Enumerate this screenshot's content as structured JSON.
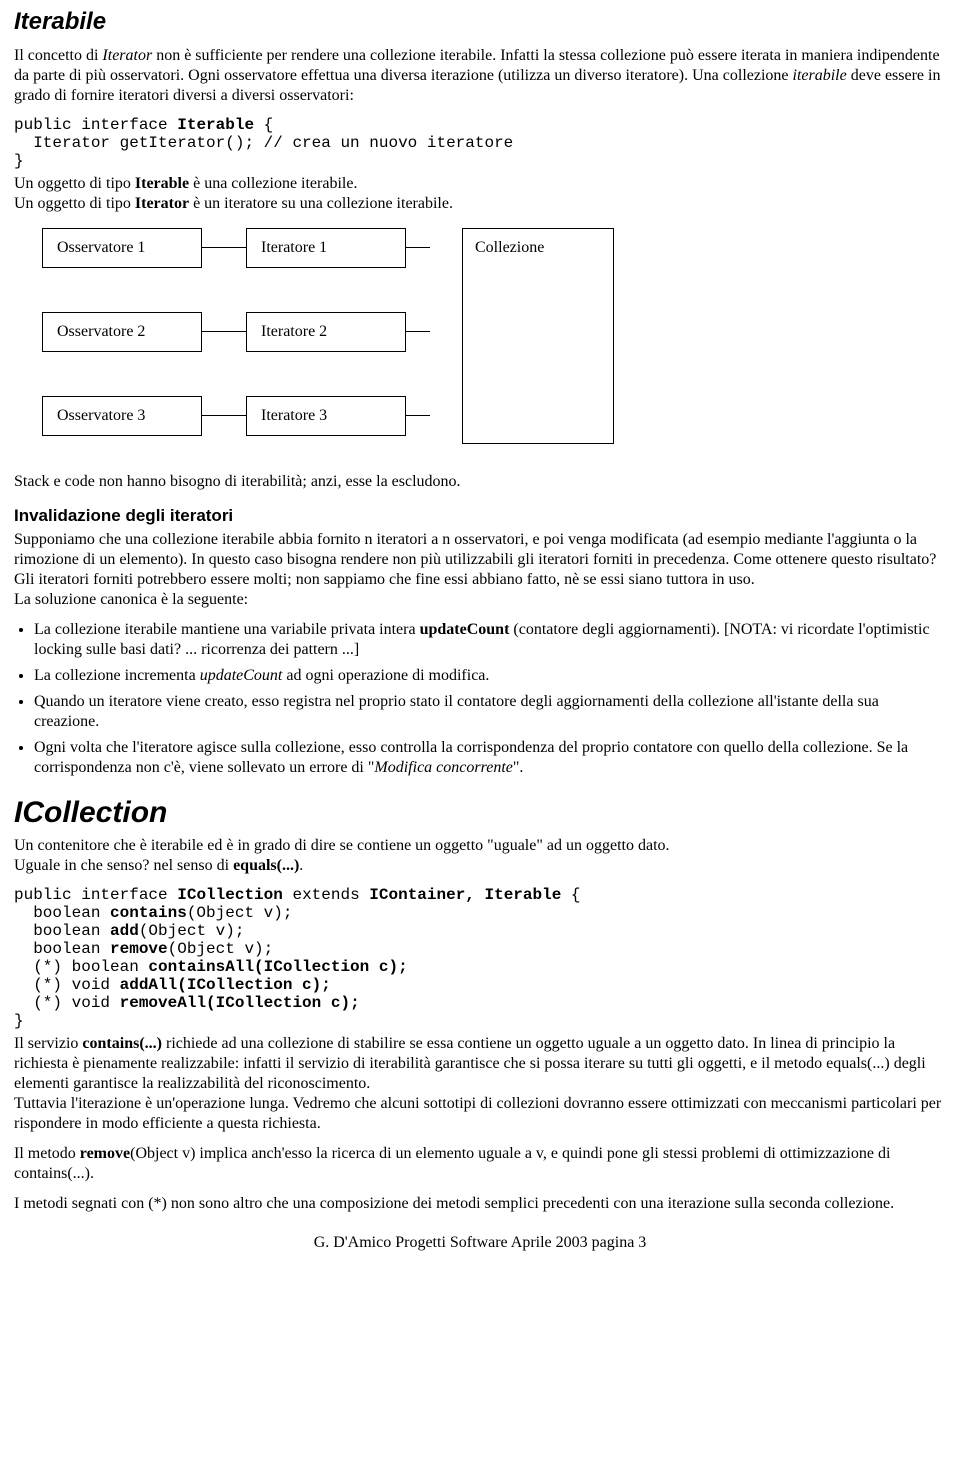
{
  "h_iterabile": "Iterabile",
  "p_iter_intro": "Il concetto di <i>Iterator</i> non è sufficiente per rendere una collezione iterabile. Infatti la stessa collezione può essere iterata in maniera indipendente da parte di più osservatori. Ogni osservatore effettua una diversa iterazione (utilizza un diverso iteratore). Una collezione <i>iterabile</i> deve essere in grado di fornire iteratori diversi a diversi osservatori:",
  "code_iterable": "public interface <b>Iterable</b> {\n  Iterator getIterator(); // crea un nuovo iteratore\n}",
  "p_iter_tail": "Un oggetto di tipo <b>Iterable</b> è una collezione iterabile.<br>Un oggetto di tipo <b>Iterator</b> è un iteratore su una collezione iterabile.",
  "diagram": {
    "obs1": "Osservatore 1",
    "obs2": "Osservatore 2",
    "obs3": "Osservatore 3",
    "it1": "Iteratore 1",
    "it2": "Iteratore 2",
    "it3": "Iteratore 3",
    "coll": "Collezione"
  },
  "p_stack": "Stack e code non hanno bisogno di iterabilità; anzi, esse la escludono.",
  "h_invalid": "Invalidazione degli iteratori",
  "p_invalid": "Supponiamo che una collezione iterabile abbia fornito n iteratori a n osservatori, e poi venga modificata (ad esempio mediante l'aggiunta o la rimozione di un elemento). In questo caso bisogna rendere non più utilizzabili gli iteratori forniti in precedenza. Come ottenere questo risultato? Gli iteratori forniti potrebbero essere molti; non sappiamo che fine essi abbiano fatto, nè se essi siano tuttora in uso.<br>La soluzione canonica è la seguente:",
  "bullets": [
    "La collezione iterabile mantiene una variabile privata intera <b>updateCount</b> (contatore degli aggiornamenti). [NOTA: vi ricordate l'optimistic locking sulle basi dati? ... ricorrenza dei pattern ...]",
    "La collezione incrementa <i>updateCount</i> ad ogni operazione di modifica.",
    "Quando un iteratore viene creato, esso registra nel proprio stato il contatore degli aggiornamenti della collezione all'istante della sua creazione.",
    "Ogni volta che l'iteratore agisce sulla collezione, esso controlla la corrispondenza del proprio contatore con quello della collezione. Se la corrispondenza non c'è, viene sollevato un errore di \"<i>Modifica concorrente</i>\"."
  ],
  "h_icollection": "ICollection",
  "p_icoll_intro": "Un contenitore che è iterabile ed è in grado di dire se contiene un oggetto \"uguale\" ad un oggetto dato.<br>Uguale in che senso? nel senso di <b>equals(...)</b>.",
  "code_icoll": "public interface <b>ICollection</b> extends <b>IContainer, Iterable</b> {\n  boolean <b>contains</b>(Object v);\n  boolean <b>add</b>(Object v);\n  boolean <b>remove</b>(Object v);\n  (*) boolean <b>containsAll(ICollection c);</b>\n  (*) void <b>addAll(ICollection c);</b>\n  (*) void <b>removeAll(ICollection c);</b>\n}",
  "p_contains": "Il servizio <b>contains(...)</b> richiede ad una collezione di stabilire se essa contiene un oggetto uguale a un oggetto dato. In linea di principio la richiesta è pienamente realizzabile: infatti il servizio di iterabilità garantisce che si possa iterare su tutti gli oggetti, e il metodo equals(...) degli elementi garantisce la realizzabilità del riconoscimento.<br>Tuttavia l'iterazione è un'operazione lunga. Vedremo che alcuni sottotipi di collezioni dovranno essere ottimizzati con meccanismi particolari per rispondere in modo efficiente a questa richiesta.",
  "p_remove": "Il metodo <b>remove</b>(Object v) implica anch'esso la ricerca di un elemento uguale a v, e quindi pone gli stessi problemi di ottimizzazione di contains(...).",
  "p_star": "I metodi segnati con (*) non sono altro che una composizione dei metodi semplici precedenti con una iterazione sulla seconda collezione.",
  "footer": "G. D'Amico Progetti Software Aprile 2003 pagina 3"
}
